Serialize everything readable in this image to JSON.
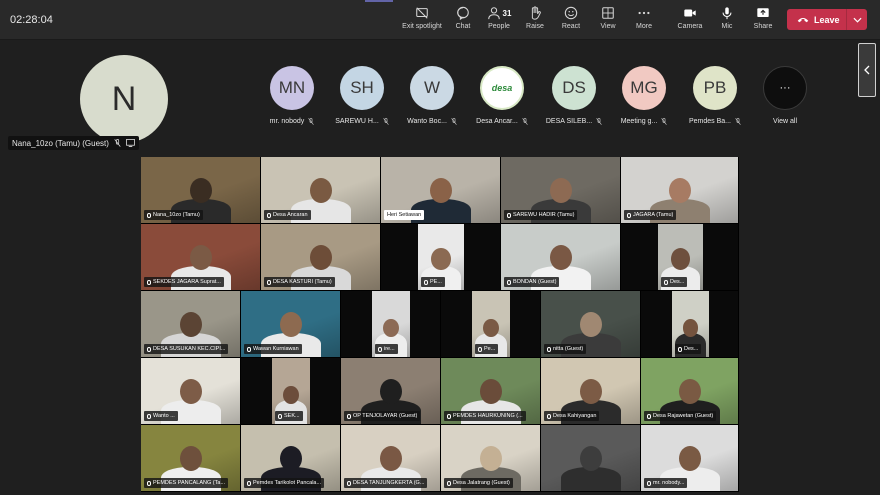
{
  "meeting": {
    "timer": "02:28:04"
  },
  "toolbar": {
    "exit_spotlight": "Exit spotlight",
    "chat": "Chat",
    "people": "People",
    "people_count": "31",
    "raise": "Raise",
    "react": "React",
    "view": "View",
    "more": "More",
    "camera": "Camera",
    "mic": "Mic",
    "share": "Share",
    "leave": "Leave"
  },
  "self_tile": {
    "initial": "N",
    "name": "Nana_10zo (Tamu) (Guest)"
  },
  "participant_strip": [
    {
      "initials": "MN",
      "label": "mr. nobody",
      "color": "#c9c4e4"
    },
    {
      "initials": "SH",
      "label": "SAREWU H...",
      "color": "#c4d6e4"
    },
    {
      "initials": "W",
      "label": "Wanto Boc...",
      "color": "#cbd9e4"
    },
    {
      "initials": "desa",
      "label": "Desa Ancar...",
      "color": "#ffffff"
    },
    {
      "initials": "DS",
      "label": "DESA SILEB...",
      "color": "#cde2d2"
    },
    {
      "initials": "MG",
      "label": "Meeting g...",
      "color": "#f1c9c2"
    },
    {
      "initials": "PB",
      "label": "Pemdes Ba...",
      "color": "#dfe4c8"
    },
    {
      "initials": "···",
      "label": "View all",
      "color": "#0e0e0e"
    }
  ],
  "video_tiles": [
    {
      "label": "Nana_10zo (Tamu)",
      "bg": "#7a6648",
      "skin": "#3a2d22",
      "shirt": "#2a2a2a"
    },
    {
      "label": "Desa Ancaran",
      "bg": "#c9c3b4",
      "skin": "#7a5a42",
      "shirt": "#e6e6e6"
    },
    {
      "label": "Heri Setiawan",
      "bg": "#b9b3a8",
      "skin": "#8a6248",
      "shirt": "#1f2a36",
      "white": true
    },
    {
      "label": "SAREWU HADIR (Tamu)",
      "bg": "#6e6a62",
      "skin": "#8d6a53",
      "shirt": "#3a3a3a"
    },
    {
      "label": "JAGARA (Tamu)",
      "bg": "#d3d2cf",
      "skin": "#a77b63",
      "shirt": "#8e8070"
    },
    {
      "label": "SEKDES JAGARA Suprat...",
      "bg": "#8a4b3a",
      "skin": "#7b5a45",
      "shirt": "#e8e8e8"
    },
    {
      "label": "DESA KASTURI (Tamu)",
      "bg": "#a89a84",
      "skin": "#6d4d38",
      "shirt": "#d9d9d9"
    },
    {
      "label": "PE...",
      "bg": "#e9e9e9",
      "skin": "#8b6a52",
      "shirt": "#f0f0f0"
    },
    {
      "label": "BONDAN (Guest)",
      "bg": "#c8ccc9",
      "skin": "#7a5844",
      "shirt": "#f2f2f2"
    },
    {
      "label": "Des...",
      "bg": "#bcbdb7",
      "skin": "#6e503e",
      "shirt": "#ececec"
    },
    {
      "label": "DESA SUSUKAN KEC.CIPI...",
      "bg": "#9a9689",
      "skin": "#5b4434",
      "shirt": "#d6d6d6"
    },
    {
      "label": "Wawan Kurniawan",
      "bg": "#2f6e85",
      "skin": "#8d6a50",
      "shirt": "#e9e9e9"
    },
    {
      "label": "ire...",
      "bg": "#d9d9d9",
      "skin": "#8c6a55",
      "shirt": "#eeeeee"
    },
    {
      "label": "Pe...",
      "bg": "#c9c4b5",
      "skin": "#7a5a45",
      "shirt": "#e8e8e8"
    },
    {
      "label": "nitta (Guest)",
      "bg": "#48504a",
      "skin": "#a08872",
      "shirt": "#3b3b3b"
    },
    {
      "label": "Des...",
      "bg": "#cfd0c6",
      "skin": "#74533e",
      "shirt": "#2a2a2a"
    },
    {
      "label": "Wanto ...",
      "bg": "#e4e1d8",
      "skin": "#7d5c47",
      "shirt": "#ededed"
    },
    {
      "label": "SEK...",
      "bg": "#b5a695",
      "skin": "#6c4d3b",
      "shirt": "#e3e3e3"
    },
    {
      "label": "OP TENJOLAYAR (Guest)",
      "bg": "#8c7f72",
      "skin": "#1f1f1f",
      "shirt": "#1f1f1f"
    },
    {
      "label": "PEMDES HAURKUNING (...",
      "bg": "#6e8a5a",
      "skin": "#6a4c3a",
      "shirt": "#e6e6e6"
    },
    {
      "label": "Desa Kahiyangan",
      "bg": "#d1c7b2",
      "skin": "#7c5b45",
      "shirt": "#2b2b2b"
    },
    {
      "label": "Desa Rajawetan (Guest)",
      "bg": "#7fa362",
      "skin": "#7a5a43",
      "shirt": "#1f1f1f"
    },
    {
      "label": "PEMDES PANCALANG (Ta...",
      "bg": "#86853f",
      "skin": "#6e503c",
      "shirt": "#efefef"
    },
    {
      "label": "Pemdes Tarikolot Pancala...",
      "bg": "#c5bfae",
      "skin": "#1c1c24",
      "shirt": "#1c1c24"
    },
    {
      "label": "DESA TANJUNGKERTA (G...",
      "bg": "#d8d0c2",
      "skin": "#7a5844",
      "shirt": "#e9e9e9"
    },
    {
      "label": "Desa Jalatrang (Guest)",
      "bg": "#d9d3c6",
      "skin": "#c4b094",
      "shirt": "#6d6a62"
    },
    {
      "label": "",
      "bg": "#5a5a5a",
      "skin": "#3d3d3d",
      "shirt": "#2e2e2e"
    },
    {
      "label": "mr. nobody...",
      "bg": "#dcdcdc",
      "skin": "#7a5a44",
      "shirt": "#ededed"
    }
  ]
}
